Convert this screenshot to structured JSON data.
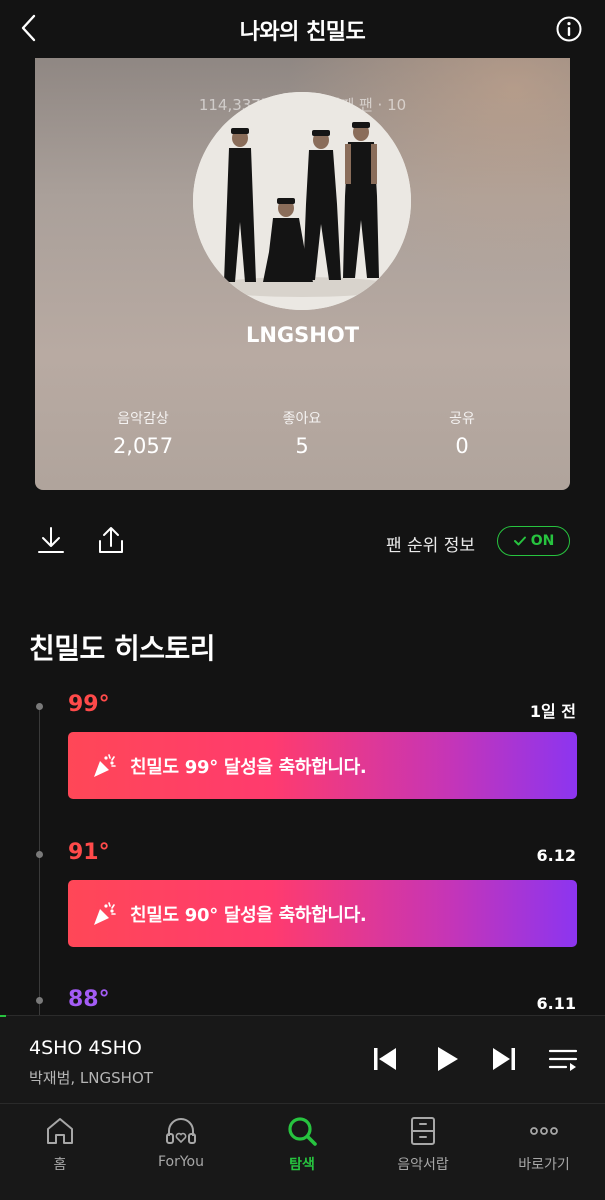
{
  "header": {
    "title": "나와의 친밀도"
  },
  "card": {
    "partial_text": "114,337명 중 284번째 팬 · 10",
    "artist_name": "LNGSHOT",
    "stats": [
      {
        "label": "음악감상",
        "value": "2,057"
      },
      {
        "label": "좋아요",
        "value": "5"
      },
      {
        "label": "공유",
        "value": "0"
      }
    ]
  },
  "actions": {
    "fan_rank_label": "팬 순위 정보",
    "toggle_label": "ON"
  },
  "history": {
    "title": "친밀도 히스토리",
    "items": [
      {
        "degree": "99°",
        "date": "1일 전",
        "banner": "친밀도 99° 달성을 축하합니다.",
        "color": "#ff4a4a"
      },
      {
        "degree": "91°",
        "date": "6.12",
        "banner": "친밀도 90° 달성을 축하합니다.",
        "color": "#ff4a4a"
      },
      {
        "degree": "88°",
        "date": "6.11",
        "color": "#a35cf5"
      }
    ]
  },
  "player": {
    "title": "4SHO 4SHO",
    "artist": "박재범, LNGSHOT",
    "progress": 0.01
  },
  "nav": {
    "items": [
      {
        "label": "홈",
        "icon": "home-icon"
      },
      {
        "label": "ForYou",
        "icon": "headphones-heart-icon"
      },
      {
        "label": "탐색",
        "icon": "search-icon",
        "active": true
      },
      {
        "label": "음악서랍",
        "icon": "drawer-icon"
      },
      {
        "label": "바로가기",
        "icon": "more-icon"
      }
    ]
  },
  "colors": {
    "accent": "#27c33f",
    "banner_start": "#ff4757",
    "banner_end": "#8c35f0"
  }
}
